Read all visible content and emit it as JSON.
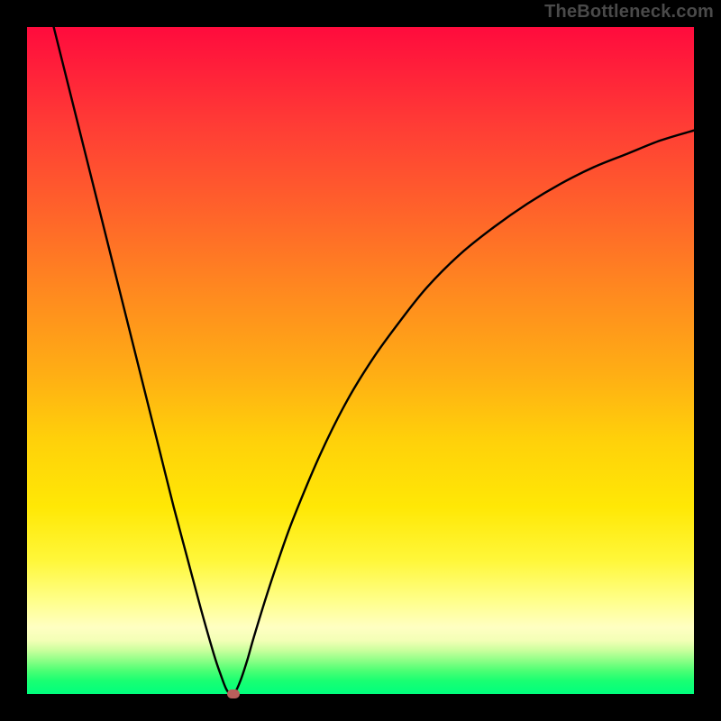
{
  "watermark": "TheBottleneck.com",
  "chart_data": {
    "type": "line",
    "title": "",
    "xlabel": "",
    "ylabel": "",
    "xlim": [
      0,
      100
    ],
    "ylim": [
      0,
      100
    ],
    "grid": false,
    "legend": false,
    "background_gradient": {
      "direction": "top-to-bottom",
      "stops": [
        {
          "pos": 0,
          "color": "#ff0b3d"
        },
        {
          "pos": 28,
          "color": "#ff642a"
        },
        {
          "pos": 62,
          "color": "#ffd10a"
        },
        {
          "pos": 86,
          "color": "#ffff8a"
        },
        {
          "pos": 95,
          "color": "#8cff86"
        },
        {
          "pos": 100,
          "color": "#00ff7d"
        }
      ]
    },
    "series": [
      {
        "name": "bottleneck-curve",
        "color": "#000000",
        "x": [
          4,
          6,
          8,
          10,
          12,
          14,
          16,
          18,
          20,
          22,
          24,
          26,
          28,
          29,
          30,
          31,
          32,
          33,
          34,
          36,
          38,
          40,
          44,
          48,
          52,
          56,
          60,
          65,
          70,
          75,
          80,
          85,
          90,
          95,
          100
        ],
        "y": [
          100,
          92,
          84,
          76,
          68,
          60,
          52,
          44,
          36,
          28,
          20.5,
          13,
          6,
          3,
          0.5,
          0,
          2,
          5,
          8.5,
          15,
          21,
          26.5,
          36,
          44,
          50.5,
          56,
          61,
          66,
          70,
          73.5,
          76.5,
          79,
          81,
          83,
          84.5
        ]
      }
    ],
    "markers": [
      {
        "name": "minimum-point",
        "x": 31,
        "y": 0,
        "color": "#b95f5c",
        "shape": "pill"
      }
    ]
  },
  "plot_geometry": {
    "outer_w": 800,
    "outer_h": 800,
    "inner_left": 30,
    "inner_top": 30,
    "inner_w": 740,
    "inner_h": 740
  }
}
